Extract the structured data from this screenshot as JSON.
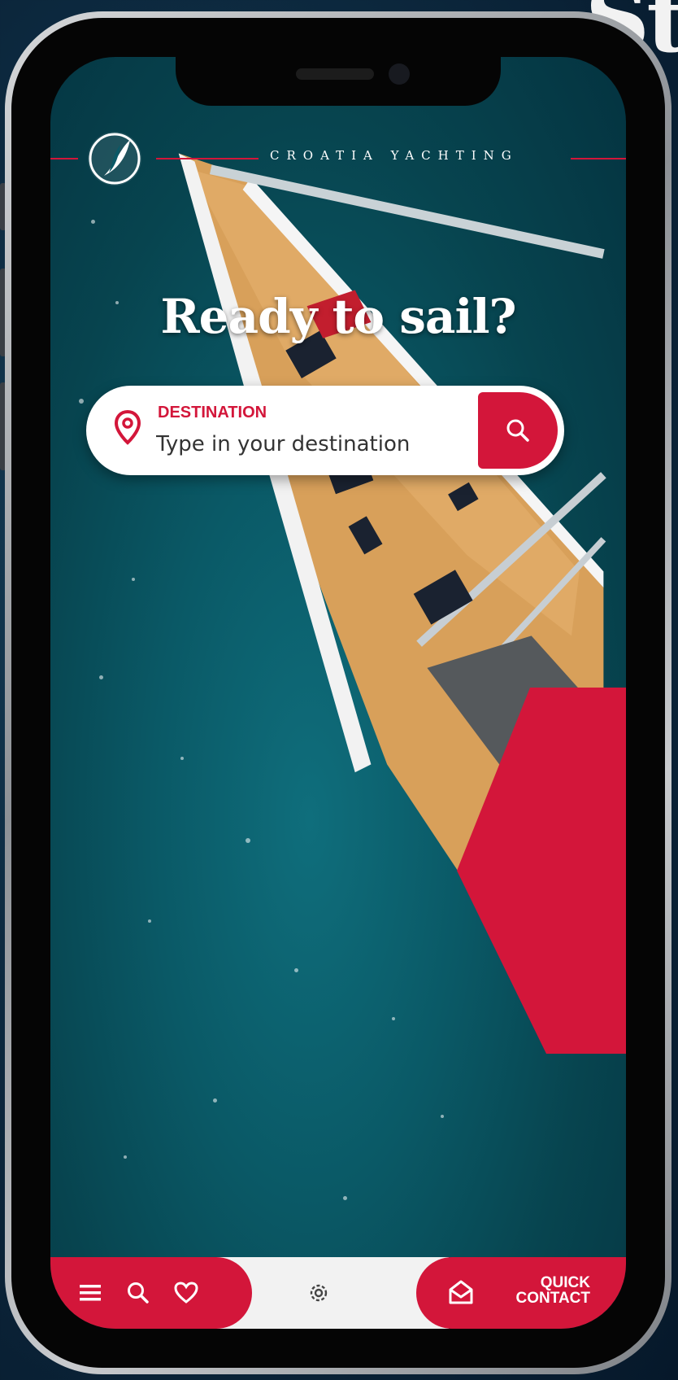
{
  "background_text": "St",
  "brand": {
    "name": "CROATIA YACHTING"
  },
  "hero": {
    "headline": "Ready to sail?"
  },
  "search": {
    "label": "DESTINATION",
    "placeholder": "Type in your destination",
    "icon": "search-icon"
  },
  "bottom_nav": {
    "items": [
      {
        "icon": "menu-icon"
      },
      {
        "icon": "search-icon"
      },
      {
        "icon": "heart-icon"
      },
      {
        "icon": "gear-icon"
      },
      {
        "icon": "mail-icon"
      }
    ],
    "quick_contact_line1": "QUICK",
    "quick_contact_line2": "CONTACT"
  },
  "colors": {
    "accent": "#d3163a",
    "sea": "#0a5966",
    "white": "#ffffff"
  }
}
